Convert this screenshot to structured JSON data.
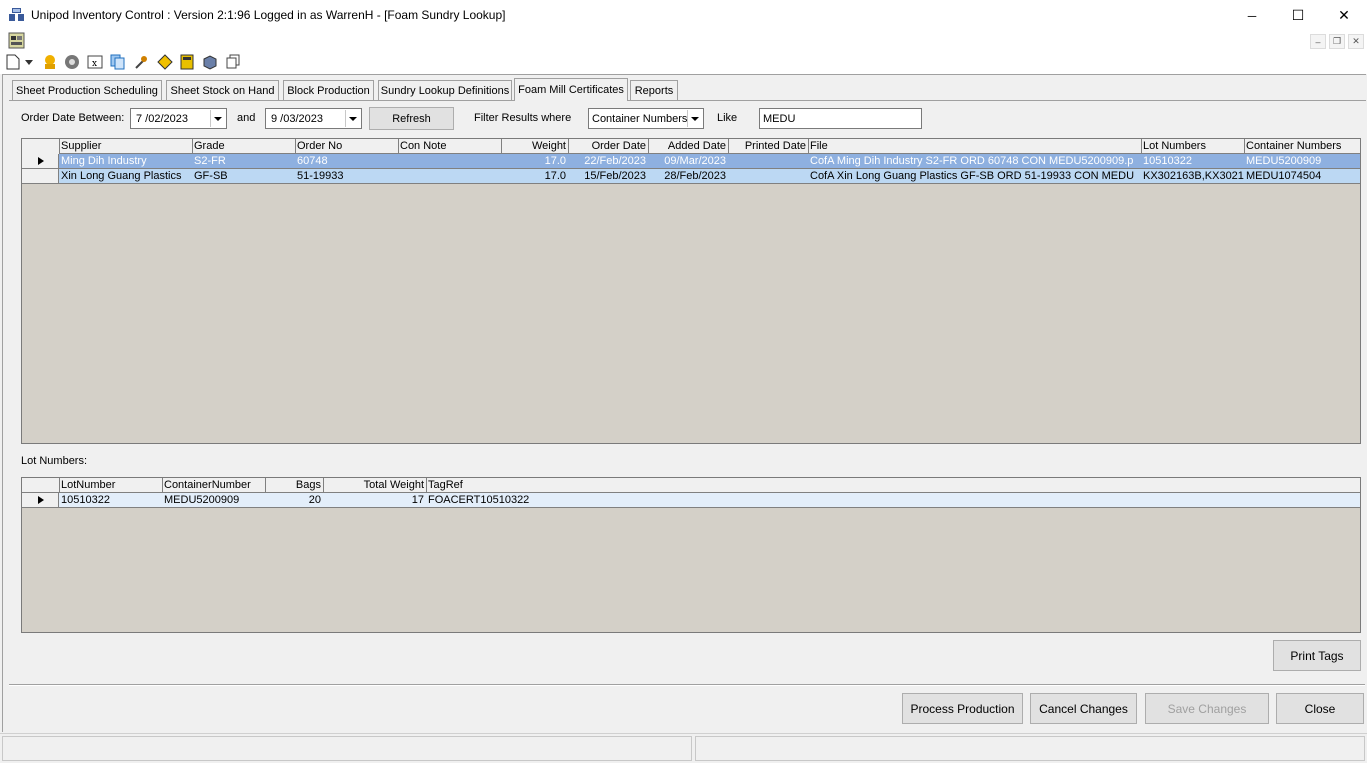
{
  "window": {
    "title": "Unipod Inventory Control : Version 2:1:96 Logged in as WarrenH - [Foam Sundry Lookup]",
    "controls": {
      "minimize": "─",
      "maximize": "☐",
      "close": "✕"
    }
  },
  "mdi_controls": {
    "minimize": "–",
    "restore": "❐",
    "close": "✕"
  },
  "tabs": [
    {
      "label": "Sheet Production Scheduling"
    },
    {
      "label": "Sheet Stock on Hand"
    },
    {
      "label": "Block Production"
    },
    {
      "label": "Sundry Lookup Definitions"
    },
    {
      "label": "Foam Mill Certificates"
    },
    {
      "label": "Reports"
    }
  ],
  "filter": {
    "order_date_label": "Order Date Between:",
    "date_from": "7 /02/2023",
    "and_label": "and",
    "date_to": "9 /03/2023",
    "refresh_label": "Refresh",
    "filter_label": "Filter Results where",
    "field": "Container Numbers",
    "like_label": "Like",
    "like_value": "MEDU"
  },
  "certificates": {
    "columns": [
      "Supplier",
      "Grade",
      "Order No",
      "Con Note",
      "Weight",
      "Order Date",
      "Added Date",
      "Printed Date",
      "File",
      "Lot Numbers",
      "Container Numbers"
    ],
    "rows": [
      [
        "Ming Dih Industry",
        "S2-FR",
        "60748",
        "",
        "17.0",
        "22/Feb/2023",
        "09/Mar/2023",
        "",
        "CofA Ming Dih Industry S2-FR ORD 60748 CON MEDU5200909.p",
        "10510322",
        "MEDU5200909"
      ],
      [
        "Xin Long Guang Plastics",
        "GF-SB",
        "51-19933",
        "",
        "17.0",
        "15/Feb/2023",
        "28/Feb/2023",
        "",
        "CofA Xin Long Guang Plastics GF-SB ORD 51-19933 CON MEDU",
        "KX302163B,KX3021",
        "MEDU1074504"
      ]
    ]
  },
  "lot_label": "Lot Numbers:",
  "lots": {
    "columns": [
      "LotNumber",
      "ContainerNumber",
      "Bags",
      "Total Weight",
      "TagRef"
    ],
    "rows": [
      [
        "10510322",
        "MEDU5200909",
        "20",
        "17",
        "FOACERT10510322"
      ]
    ]
  },
  "buttons": {
    "print_tags": "Print Tags",
    "process_production": "Process Production",
    "cancel_changes": "Cancel Changes",
    "save_changes": "Save Changes",
    "close": "Close"
  },
  "colors": {
    "selected_row": "#8eb0e0",
    "alt_row": "#bcd8f3",
    "grid_bg": "#d4d0c8"
  }
}
